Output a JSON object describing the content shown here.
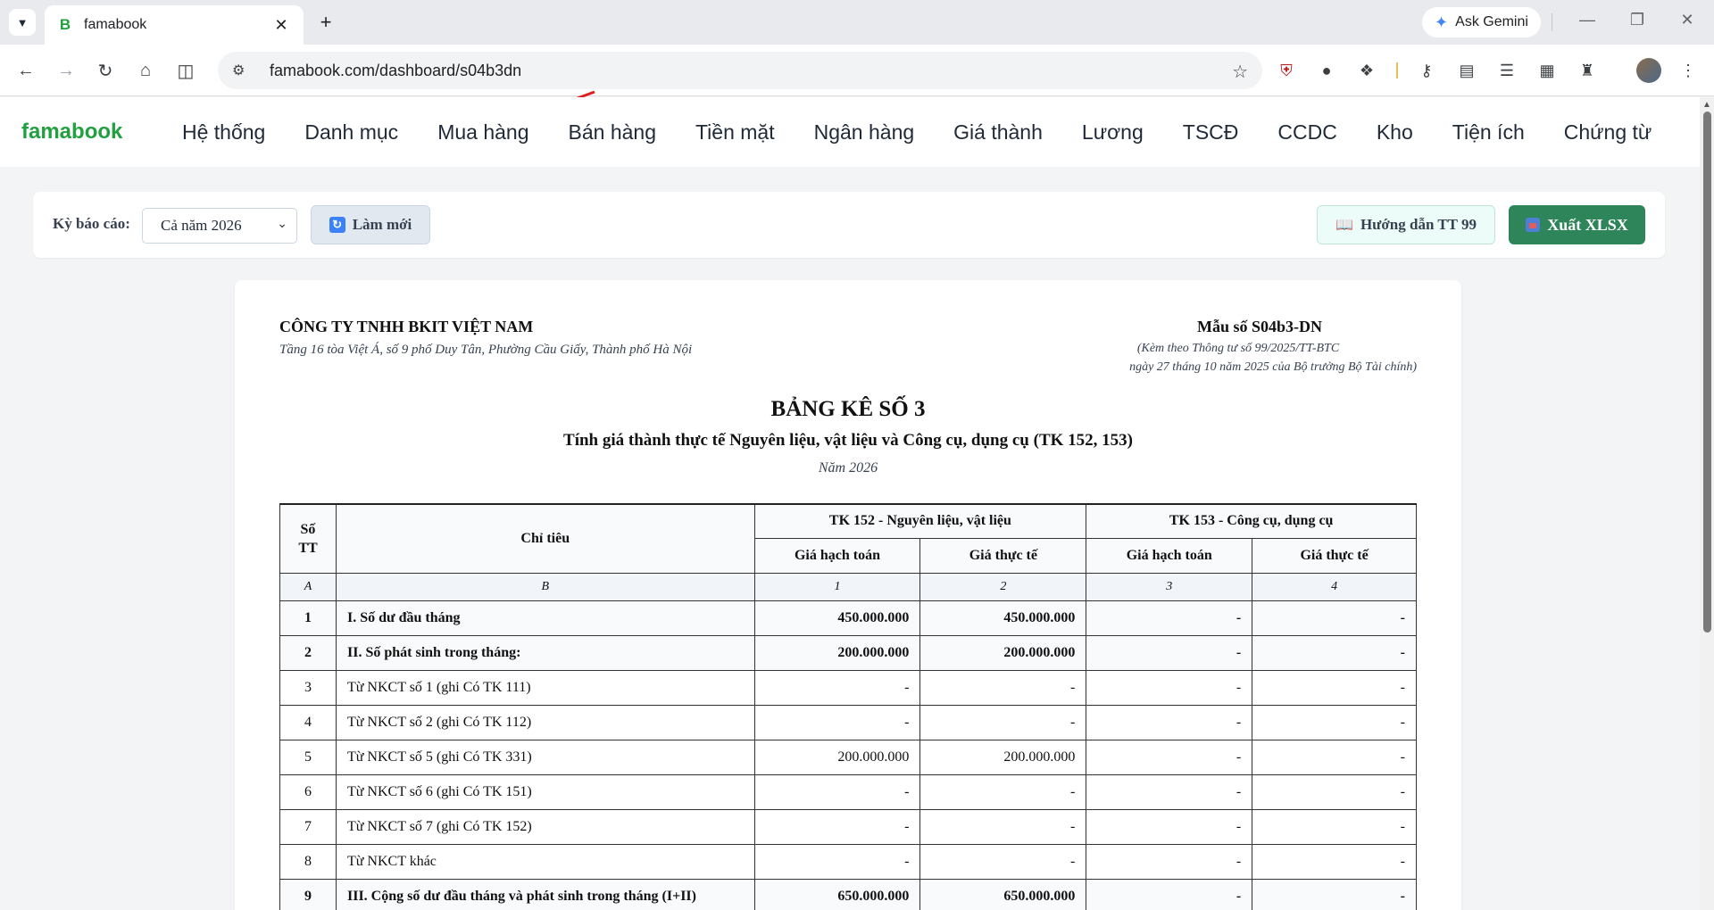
{
  "browser": {
    "tab_title": "famabook",
    "tab_favicon": "B",
    "url": "famabook.com/dashboard/s04b3dn",
    "gemini_label": "Ask Gemini"
  },
  "app": {
    "brand": "famabook",
    "menu": [
      "Hệ thống",
      "Danh mục",
      "Mua hàng",
      "Bán hàng",
      "Tiền mặt",
      "Ngân hàng",
      "Giá thành",
      "Lương",
      "TSCĐ",
      "CCDC",
      "Kho",
      "Tiện ích",
      "Chứng từ"
    ]
  },
  "toolbar": {
    "period_label": "Kỳ báo cáo:",
    "period_value": "Cả năm 2026",
    "refresh_label": "Làm mới",
    "guide_label": "Hướng dẫn TT 99",
    "export_label": "Xuất XLSX"
  },
  "report": {
    "company": "CÔNG TY TNHH BKIT VIỆT NAM",
    "address": "Tầng 16 tòa Việt Á, số 9 phố Duy Tân, Phường Cầu Giấy, Thành phố Hà Nội",
    "form_no": "Mẫu số S04b3-DN",
    "form_note1": "(Kèm theo Thông tư số 99/2025/TT-BTC",
    "form_note2": "ngày 27 tháng 10 năm 2025 của Bộ trưởng Bộ Tài chính)",
    "title": "BẢNG KÊ SỐ 3",
    "subtitle": "Tính giá thành thực tế Nguyên liệu, vật liệu và Công cụ, dụng cụ (TK 152, 153)",
    "year": "Năm 2026",
    "headers": {
      "stt": "Số TT",
      "chi_tieu": "Chỉ tiêu",
      "tk152": "TK 152 - Nguyên liệu, vật liệu",
      "tk153": "TK 153 - Công cụ, dụng cụ",
      "gia_hach_toan": "Giá hạch toán",
      "gia_thuc_te": "Giá thực tế"
    },
    "col_letters": [
      "A",
      "B",
      "1",
      "2",
      "3",
      "4"
    ],
    "rows": [
      {
        "stt": "1",
        "label": "I. Số dư đầu tháng",
        "c1": "450.000.000",
        "c2": "450.000.000",
        "c3": "-",
        "c4": "-",
        "bold": true
      },
      {
        "stt": "2",
        "label": "II. Số phát sinh trong tháng:",
        "c1": "200.000.000",
        "c2": "200.000.000",
        "c3": "-",
        "c4": "-",
        "bold": true
      },
      {
        "stt": "3",
        "label": "Từ NKCT số 1 (ghi Có TK 111)",
        "c1": "-",
        "c2": "-",
        "c3": "-",
        "c4": "-",
        "bold": false
      },
      {
        "stt": "4",
        "label": "Từ NKCT số 2 (ghi Có TK 112)",
        "c1": "-",
        "c2": "-",
        "c3": "-",
        "c4": "-",
        "bold": false
      },
      {
        "stt": "5",
        "label": "Từ NKCT số 5 (ghi Có TK 331)",
        "c1": "200.000.000",
        "c2": "200.000.000",
        "c3": "-",
        "c4": "-",
        "bold": false
      },
      {
        "stt": "6",
        "label": "Từ NKCT số 6 (ghi Có TK 151)",
        "c1": "-",
        "c2": "-",
        "c3": "-",
        "c4": "-",
        "bold": false
      },
      {
        "stt": "7",
        "label": "Từ NKCT số 7 (ghi Có TK 152)",
        "c1": "-",
        "c2": "-",
        "c3": "-",
        "c4": "-",
        "bold": false
      },
      {
        "stt": "8",
        "label": "Từ NKCT khác",
        "c1": "-",
        "c2": "-",
        "c3": "-",
        "c4": "-",
        "bold": false
      },
      {
        "stt": "9",
        "label": "III. Cộng số dư đầu tháng và phát sinh trong tháng (I+II)",
        "c1": "650.000.000",
        "c2": "650.000.000",
        "c3": "-",
        "c4": "-",
        "bold": true
      }
    ]
  }
}
